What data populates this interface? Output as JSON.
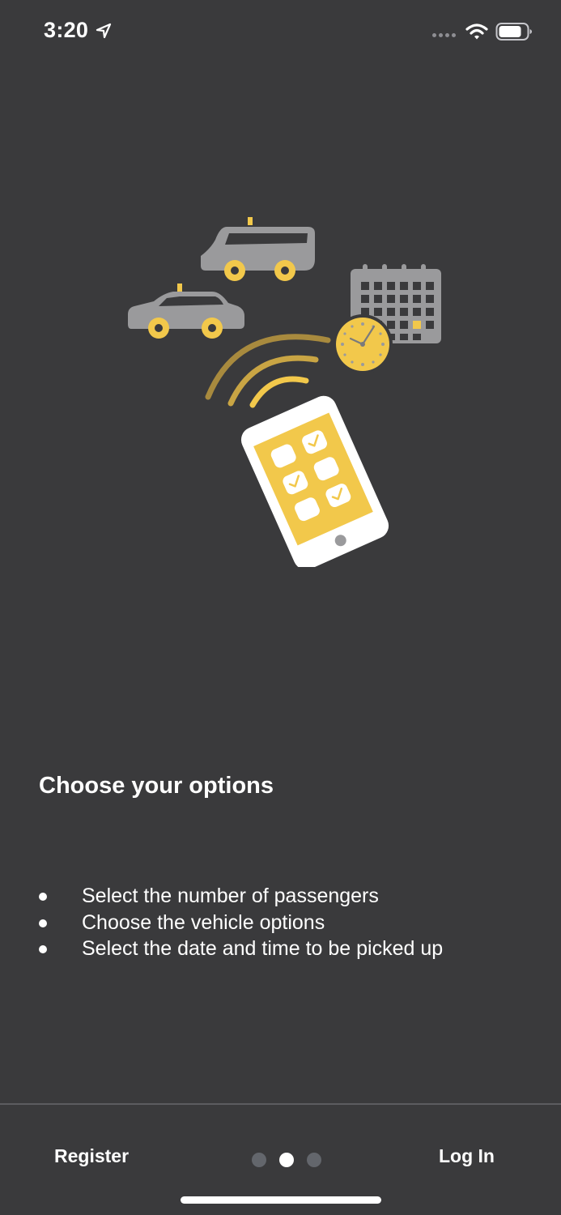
{
  "status_bar": {
    "time": "3:20"
  },
  "onboarding": {
    "title": "Choose your options",
    "features": [
      "Select the number of passengers",
      "Choose the vehicle options",
      "Select the date and time to be picked up"
    ],
    "page_count": 3,
    "current_page": 2
  },
  "footer": {
    "register_label": "Register",
    "login_label": "Log In"
  },
  "colors": {
    "background": "#3a3a3c",
    "accent_yellow": "#f2c84b",
    "vehicle_gray": "#9a9a9c",
    "text": "#ffffff",
    "dot_inactive": "#63666c"
  },
  "icons": {
    "illustration": "taxi-booking-illustration",
    "status": [
      "location-arrow-icon",
      "cellular-signal-icon",
      "wifi-icon",
      "battery-icon"
    ]
  }
}
